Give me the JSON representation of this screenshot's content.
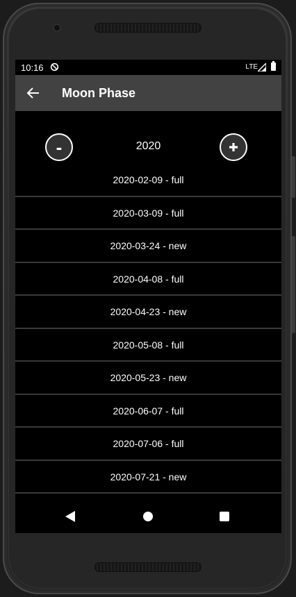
{
  "status_bar": {
    "time": "10:16",
    "network": "LTE",
    "icons": [
      "sync-icon",
      "signal-icon",
      "battery-icon"
    ]
  },
  "app_bar": {
    "back_icon": "arrow-left-icon",
    "title": "Moon Phase"
  },
  "year_selector": {
    "decrement_label": "-",
    "increment_icon": "plus-icon",
    "year": "2020"
  },
  "phases": [
    "2020-02-09 - full",
    "2020-03-09 - full",
    "2020-03-24 - new",
    "2020-04-08 - full",
    "2020-04-23 - new",
    "2020-05-08 - full",
    "2020-05-23 - new",
    "2020-06-07 - full",
    "2020-07-06 - full",
    "2020-07-21 - new"
  ],
  "nav_bar": {
    "icons": [
      "nav-back-icon",
      "nav-home-icon",
      "nav-recents-icon"
    ]
  },
  "colors": {
    "app_bar": "#424242",
    "screen_background": "#000000",
    "divider": "#3a3a3a",
    "text": "#ffffff"
  }
}
